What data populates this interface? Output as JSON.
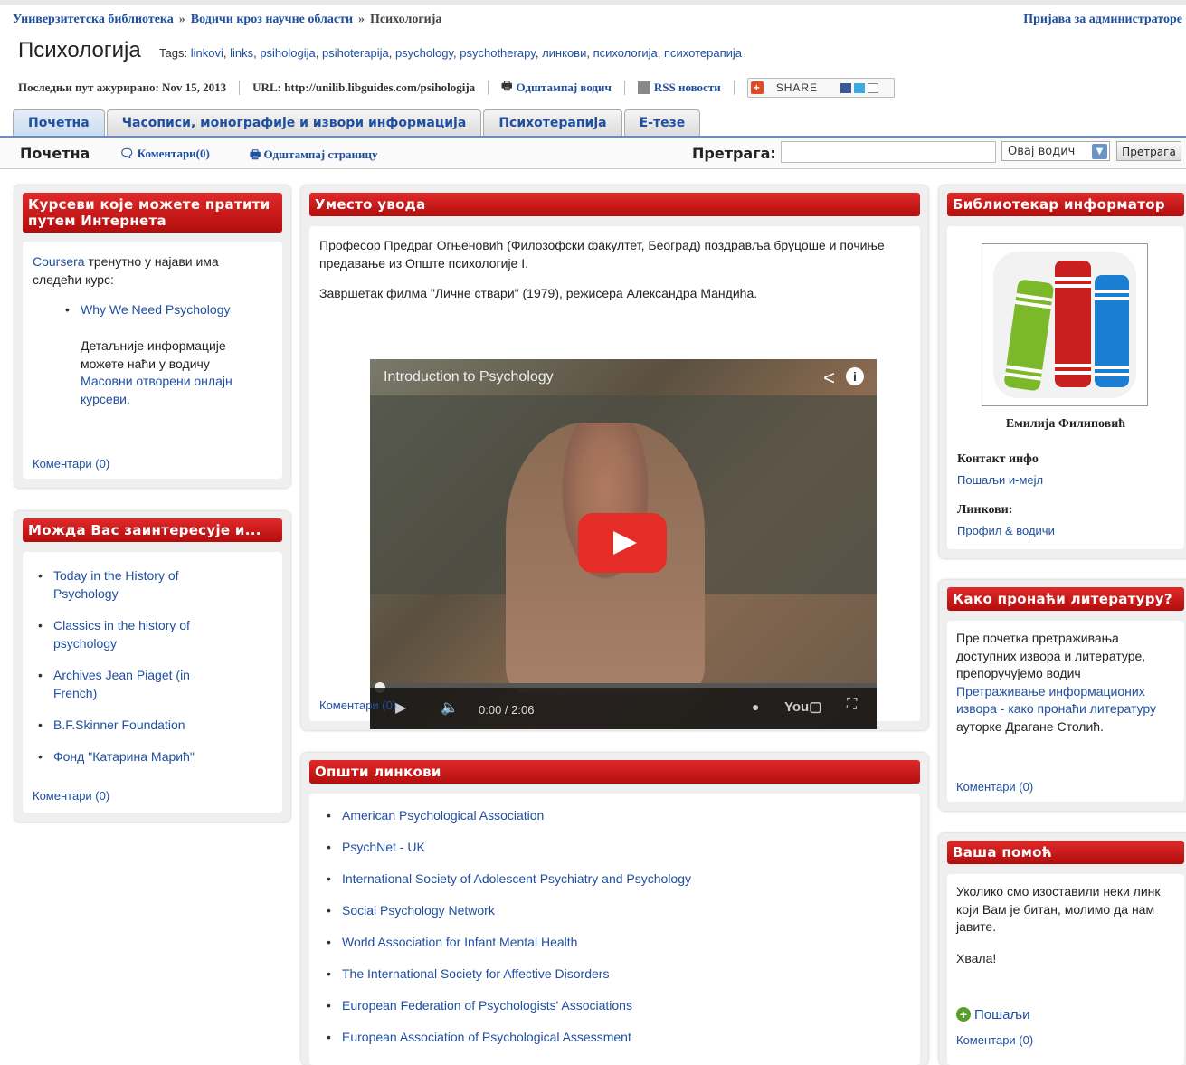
{
  "breadcrumb": {
    "items": [
      "Универзитетска библиотека",
      "Водичи кроз научне области",
      "Психологија"
    ],
    "sep": "»"
  },
  "admin_login": "Пријава за администраторе",
  "page_title": "Психологија",
  "tags": {
    "label": "Tags:",
    "items": [
      "linkovi",
      "links",
      "psihologija",
      "psihoterapija",
      "psychology",
      "psychotherapy",
      "линкови",
      "психологија",
      "психотерапија"
    ]
  },
  "meta": {
    "updated": "Последњи пут ажурирано: Nov 15, 2013",
    "url": "URL: http://unilib.libguides.com/psihologija",
    "print_guide": "Одштампај водич",
    "rss": "RSS новости",
    "share": "SHARE"
  },
  "tabs": [
    "Почетна",
    "Часописи, монографије и извори информација",
    "Психотерапија",
    "Е-тезе"
  ],
  "subnav": {
    "home": "Почетна",
    "comments": "Коментари(0)",
    "print_page": "Одштампај страницу",
    "search_label": "Претрага:",
    "search_value": "",
    "scope": "Овај водич",
    "search_button": "Претрага"
  },
  "courses_box": {
    "title": "Курсеви које можете пратити путем Интернета",
    "intro_link": "Coursera",
    "intro_text": " тренутно у најави има следећи курс:",
    "course": "Why We Need Psychology",
    "more_text": "Детаљније информације можете наћи у водичу ",
    "more_link": "Масовни отворени онлајн курсеви.",
    "comments": "Коментари (0)"
  },
  "interest_box": {
    "title": "Можда Вас заинтересује и...",
    "items": [
      "Today in the History of Psychology",
      "Classics in the history of psychology",
      "Archives Jean Piaget (in French)",
      "B.F.Skinner Foundation",
      "Фонд \"Катарина Марић\""
    ],
    "comments": "Коментари (0)"
  },
  "intro_box": {
    "title": "Уместо увода",
    "p1": "Професор Предраг Огњеновић (Филозофски факултет, Београд) поздравља бруцоше и почиње предавање из Опште психологије I.",
    "p2": "Завршетак филма \"Личне ствари\" (1979), режисера Александра Мандића.",
    "video_title": "Introduction to Psychology",
    "video_time": "0:00 / 2:06",
    "video_progress": 0,
    "comments": "Коментари (0)"
  },
  "links_box": {
    "title": "Општи линкови",
    "items": [
      "American Psychological Association",
      "PsychNet - UK",
      "International Society of Adolescent Psychiatry and Psychology",
      "Social Psychology Network",
      "World Association for Infant Mental Health",
      "The International Society for Affective Disorders",
      "European Federation of Psychologists' Associations",
      "European Association of Psychological Assessment"
    ]
  },
  "librarian_box": {
    "title": "Библиотекар информатор",
    "name": "Емилија Филиповић",
    "contact_label": "Контакт инфо",
    "contact_link": "Пошаљи и-мејл",
    "links_label": "Линкови:",
    "links_link": "Профил & водичи"
  },
  "literature_box": {
    "title": "Како пронаћи литературу?",
    "text1": "Пре почетка претраживања доступних извора и литературе, препоручујемо водич ",
    "link": "Претраживање информационих извора - како пронаћи литературу",
    "text2": " ауторке Драгане Столић.",
    "comments": "Коментари (0)"
  },
  "help_box": {
    "title": "Ваша помоћ",
    "text": "Уколико смо изоставили неки линк који Вам је битан, молимо да нам јавите.",
    "thanks": "Хвала!",
    "send": "Пошаљи",
    "comments": "Коментари (0)"
  },
  "colors": {
    "accent": "#c41a1a",
    "link": "#1f4fa0",
    "book_green": "#7bb82a",
    "book_red": "#c8201e",
    "book_blue": "#1a7fd0"
  }
}
